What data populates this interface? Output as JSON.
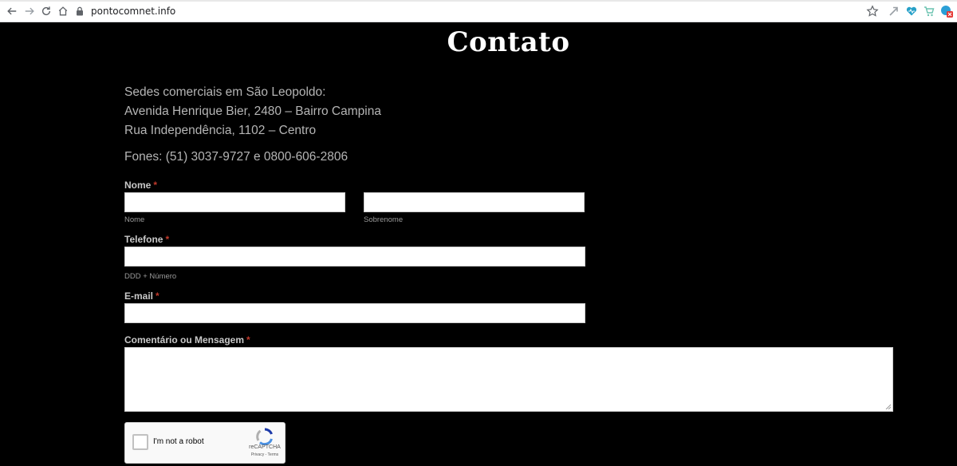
{
  "browser": {
    "url": "pontocomnet.info",
    "icons": [
      "back-icon",
      "forward-icon",
      "reload-icon",
      "home-icon",
      "lock-icon",
      "star-icon",
      "extension-icons"
    ]
  },
  "page": {
    "title": "Contato",
    "address_lines": [
      "Sedes comerciais em São Leopoldo:",
      "Avenida Henrique Bier, 2480 – Bairro Campina",
      "Rua Independência, 1102 – Centro"
    ],
    "phones": "Fones: (51) 3037-9727 e 0800-606-2806"
  },
  "form": {
    "required_mark": "*",
    "name": {
      "label": "Nome",
      "first_sub": "Nome",
      "last_sub": "Sobrenome",
      "first_value": "",
      "last_value": ""
    },
    "phone": {
      "label": "Telefone",
      "sub": "DDD + Número",
      "value": ""
    },
    "email": {
      "label": "E-mail",
      "value": ""
    },
    "message": {
      "label": "Comentário ou Mensagem",
      "value": ""
    }
  },
  "recaptcha": {
    "label": "I'm not a robot",
    "brand": "reCAPTCHA",
    "links": "Privacy - Terms"
  },
  "colors": {
    "background": "#000000",
    "required": "#c0392b",
    "text_muted": "#b5b5b5"
  }
}
